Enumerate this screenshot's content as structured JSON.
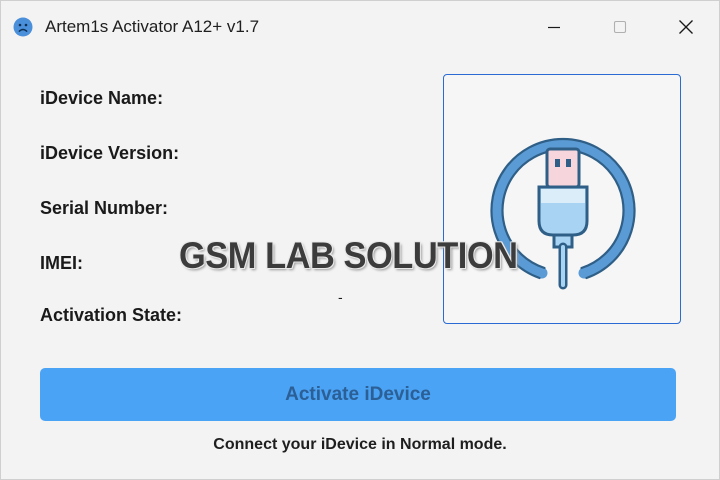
{
  "window": {
    "title": "Artem1s Activator A12+ v1.7",
    "app_icon": "sad-face-icon",
    "controls": {
      "minimize_icon": "minimize-icon",
      "maximize_icon": "maximize-icon",
      "close_icon": "close-icon"
    }
  },
  "device_info": {
    "name_label": "iDevice Name:",
    "version_label": "iDevice Version:",
    "serial_label": "Serial Number:",
    "imei_label": "IMEI:",
    "activation_label": "Activation State:",
    "activation_value": "-"
  },
  "image_panel": {
    "icon": "usb-cable-icon"
  },
  "watermark": {
    "text": "GSM LAB SOLUTION"
  },
  "actions": {
    "activate_label": "Activate iDevice"
  },
  "status": {
    "message": "Connect your iDevice in Normal mode."
  },
  "colors": {
    "accent": "#4aa3f5",
    "button_text": "#2c5f95",
    "panel_border": "#2a6bd3",
    "background": "#f3f3f3",
    "icon_blue": "#5b9bd5",
    "icon_pink": "#f7d5dc"
  }
}
